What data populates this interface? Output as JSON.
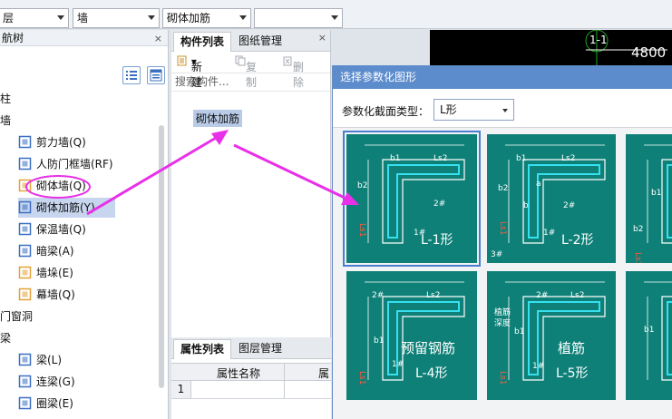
{
  "filters": {
    "floor": "层",
    "category": "墙",
    "component": "砌体加筋",
    "extra": ""
  },
  "nav": {
    "title": "航树",
    "close_label": "×",
    "items": [
      {
        "label": "柱",
        "level": 0
      },
      {
        "label": "墙",
        "level": 0
      },
      {
        "label": "剪力墙(Q)",
        "level": 1,
        "icon": "shear-wall-icon"
      },
      {
        "label": "人防门框墙(RF)",
        "level": 1,
        "icon": "civil-defense-door-frame-icon"
      },
      {
        "label": "砌体墙(Q)",
        "level": 1,
        "icon": "masonry-wall-icon"
      },
      {
        "label": "砌体加筋(Y)",
        "level": 1,
        "icon": "masonry-reinforcement-icon",
        "selected": true
      },
      {
        "label": "保温墙(Q)",
        "level": 1,
        "icon": "insulation-wall-icon"
      },
      {
        "label": "暗梁(A)",
        "level": 1,
        "icon": "hidden-beam-icon"
      },
      {
        "label": "墙垛(E)",
        "level": 1,
        "icon": "wall-pier-icon"
      },
      {
        "label": "幕墙(Q)",
        "level": 1,
        "icon": "curtain-wall-icon"
      },
      {
        "label": "门窗洞",
        "level": 0
      },
      {
        "label": "梁",
        "level": 0
      },
      {
        "label": "梁(L)",
        "level": 1,
        "icon": "beam-icon"
      },
      {
        "label": "连梁(G)",
        "level": 1,
        "icon": "link-beam-icon"
      },
      {
        "label": "圈梁(E)",
        "level": 1,
        "icon": "ring-beam-icon"
      }
    ]
  },
  "components": {
    "tabs": [
      "构件列表",
      "图纸管理"
    ],
    "close_label": "×",
    "new_label": "新建",
    "copy_label": "复制",
    "delete_label": "删除",
    "search_placeholder": "搜索构件...",
    "selected_item": "砌体加筋"
  },
  "properties": {
    "tabs": [
      "属性列表",
      "图层管理"
    ],
    "col_name": "属性名称",
    "col_value": "属",
    "row_index": "1"
  },
  "cad": {
    "axis_label": "1-1",
    "dimension": "4800"
  },
  "dialog": {
    "title": "选择参数化图形",
    "type_label": "参数化截面类型：",
    "type_value": "L形",
    "tiles": [
      {
        "id": "L-1",
        "caption": "L-1形",
        "labels": [
          "b1",
          "Ls2",
          "b2",
          "2#",
          "1#",
          "Ls1"
        ]
      },
      {
        "id": "L-2",
        "caption": "L-2形",
        "labels": [
          "b1",
          "Ls2",
          "b2",
          "a",
          "b",
          "2#",
          "1#",
          "3#",
          "Ls1"
        ]
      },
      {
        "id": "L-3",
        "caption": "",
        "labels": [
          "b1",
          "b2",
          "Ls1"
        ]
      },
      {
        "id": "L-4",
        "caption": "L-4形",
        "extra": "预留钢筋",
        "labels": [
          "2#",
          "Ls2",
          "b1",
          "1#",
          "Ls1"
        ]
      },
      {
        "id": "L-5",
        "caption": "L-5形",
        "extra": "植筋",
        "labels": [
          "2#",
          "Ls2",
          "植筋",
          "深度",
          "b1",
          "1#",
          "Ls1"
        ]
      },
      {
        "id": "L-6",
        "caption": "",
        "labels": [
          "b1"
        ]
      }
    ]
  },
  "colors": {
    "tile_bg": "#0e8078",
    "tile_line": "#36e0ef",
    "annotation": "#e830e8",
    "title_bar": "#5d8ccd"
  }
}
